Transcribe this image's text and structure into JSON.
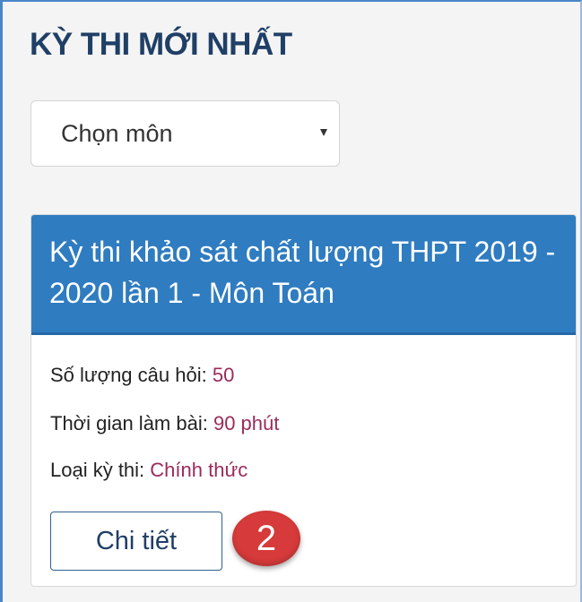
{
  "section": {
    "title": "KỲ THI MỚI NHẤT"
  },
  "subject_select": {
    "selected": "Chọn môn"
  },
  "exam_card": {
    "title": "Kỳ thi khảo sát chất lượng THPT 2019 - 2020 lần 1 - Môn Toán",
    "question_count_label": "Số lượng câu hỏi:",
    "question_count_value": "50",
    "duration_label": "Thời gian làm bài:",
    "duration_value": "90 phút",
    "exam_type_label": "Loại kỳ thi:",
    "exam_type_value": "Chính thức",
    "detail_button_label": "Chi tiết"
  },
  "annotation": {
    "step_number": "2"
  },
  "colors": {
    "header_bg": "#2f7cc0",
    "title_text": "#1f3f66",
    "value_text": "#9c2a5c",
    "badge_bg": "#d63a3a"
  },
  "icons": {
    "select_caret": "caret-down-icon"
  }
}
